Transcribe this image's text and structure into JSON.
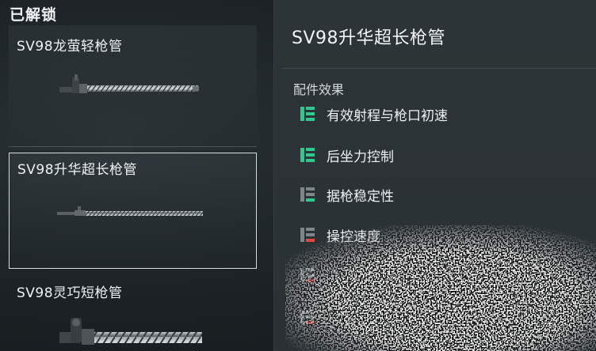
{
  "left_list": {
    "section_title": "已解锁",
    "items": [
      {
        "name": "SV98龙萤轻枪管",
        "selected": false
      },
      {
        "name": "SV98升华超长枪管",
        "selected": true
      },
      {
        "name": "SV98灵巧短枪管",
        "selected": false
      }
    ]
  },
  "detail": {
    "title": "SV98升华超长枪管",
    "effects_label": "配件效果",
    "effects": [
      {
        "label": "有效射程与枪口初速",
        "icon": "stat-up-3-icon",
        "level": 3,
        "direction": "up"
      },
      {
        "label": "后坐力控制",
        "icon": "stat-up-3-icon",
        "level": 3,
        "direction": "up"
      },
      {
        "label": "据枪稳定性",
        "icon": "stat-up-1-icon",
        "level": 1,
        "direction": "up"
      },
      {
        "label": "操控速度",
        "icon": "stat-down-icon",
        "level": 1,
        "direction": "down"
      },
      {
        "label": "",
        "icon": "stat-down-icon",
        "level": 1,
        "direction": "down"
      },
      {
        "label": "",
        "icon": "stat-down-icon",
        "level": 1,
        "direction": "down"
      }
    ]
  },
  "colors": {
    "positive": "#2fc98f",
    "negative": "#e04646",
    "neutral": "#7d868a",
    "panel": "#2d3437"
  }
}
